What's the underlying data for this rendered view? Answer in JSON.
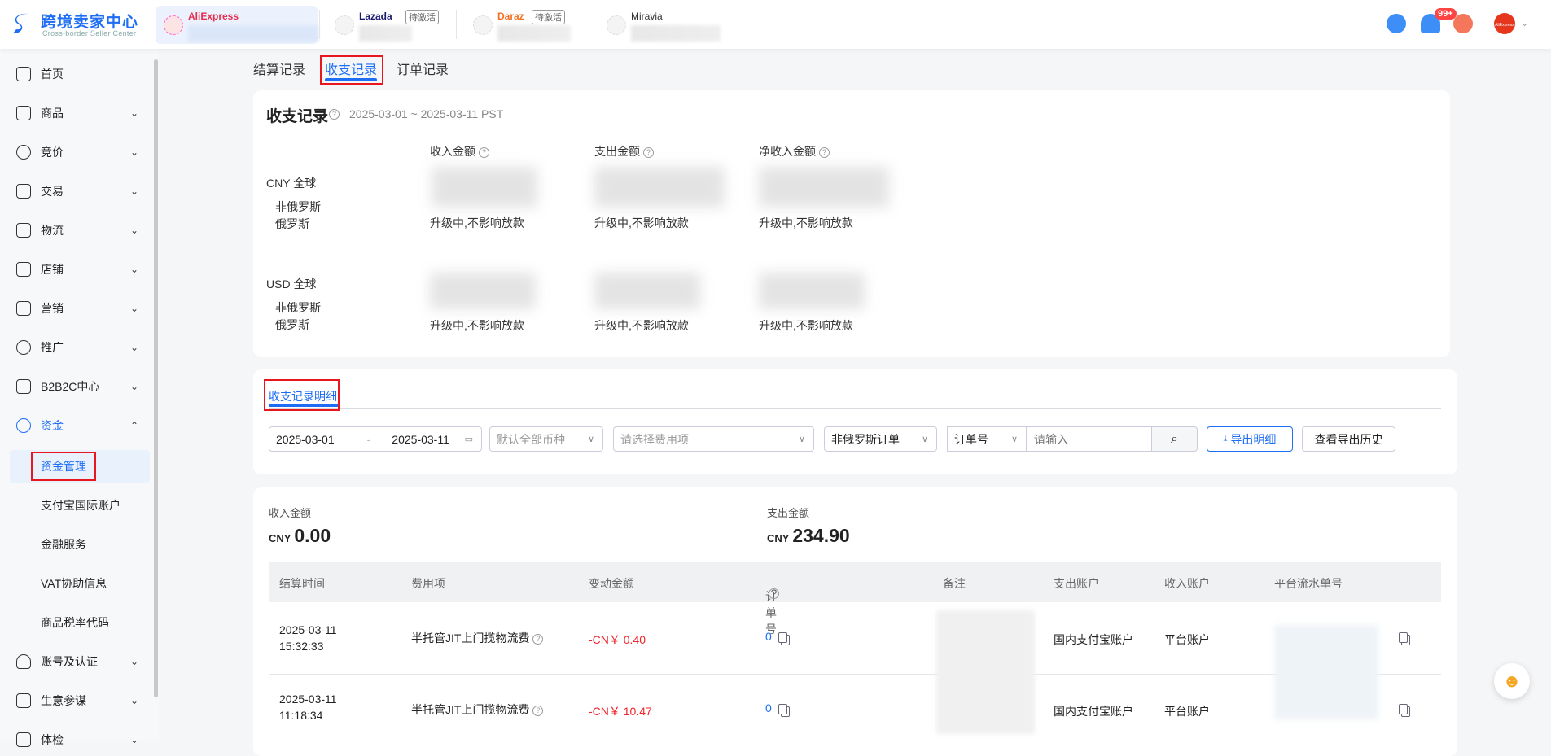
{
  "header": {
    "logo_title": "跨境卖家中心",
    "logo_subtitle": "Cross-border Seller Center",
    "shops": [
      {
        "name": "AliExpress",
        "badge": ""
      },
      {
        "name": "Lazada",
        "badge": "待激活"
      },
      {
        "name": "Daraz",
        "badge": "待激活"
      },
      {
        "name": "Miravia",
        "badge": ""
      }
    ],
    "notification_count": "99+",
    "avatar_text": "AliExpress"
  },
  "sidebar": {
    "items": [
      {
        "label": "首页"
      },
      {
        "label": "商品"
      },
      {
        "label": "竞价"
      },
      {
        "label": "交易"
      },
      {
        "label": "物流"
      },
      {
        "label": "店铺"
      },
      {
        "label": "营销"
      },
      {
        "label": "推广"
      },
      {
        "label": "B2B2C中心"
      },
      {
        "label": "资金"
      },
      {
        "label": "账号及认证"
      },
      {
        "label": "生意参谋"
      },
      {
        "label": "体检"
      }
    ],
    "sub_items": [
      {
        "label": "资金管理"
      },
      {
        "label": "支付宝国际账户"
      },
      {
        "label": "金融服务"
      },
      {
        "label": "VAT协助信息"
      },
      {
        "label": "商品税率代码"
      }
    ]
  },
  "tabs": [
    {
      "label": "结算记录"
    },
    {
      "label": "收支记录"
    },
    {
      "label": "订单记录"
    }
  ],
  "summary": {
    "title": "收支记录",
    "date_range": "2025-03-01 ~ 2025-03-11 PST",
    "columns": [
      "收入金额",
      "支出金额",
      "净收入金额"
    ],
    "groups": [
      {
        "label": "CNY 全球",
        "sub": [
          "非俄罗斯",
          "俄罗斯"
        ]
      },
      {
        "label": "USD 全球",
        "sub": [
          "非俄罗斯",
          "俄罗斯"
        ]
      }
    ],
    "upgrading_text": "升级中,不影响放款"
  },
  "detail": {
    "tab": "收支记录明细",
    "date_start": "2025-03-01",
    "date_end": "2025-03-11",
    "currency_placeholder": "默认全部币种",
    "fee_placeholder": "请选择费用项",
    "region": "非俄罗斯订单",
    "search_type": "订单号",
    "search_placeholder": "请输入",
    "export": "导出明细",
    "history": "查看导出历史"
  },
  "totals": {
    "income_label": "收入金额",
    "income_currency": "CNY",
    "income_value": "0.00",
    "expense_label": "支出金额",
    "expense_currency": "CNY",
    "expense_value": "234.90"
  },
  "table": {
    "headers": [
      "结算时间",
      "费用项",
      "变动金额",
      "订单号",
      "备注",
      "支出账户",
      "收入账户",
      "平台流水单号"
    ],
    "rows": [
      {
        "date": "2025-03-11",
        "time": "15:32:33",
        "fee": "半托管JIT上门揽物流费",
        "amount": "-CN￥ 0.40",
        "order": "0",
        "out": "国内支付宝账户",
        "in": "平台账户"
      },
      {
        "date": "2025-03-11",
        "time": "11:18:34",
        "fee": "半托管JIT上门揽物流费",
        "amount": "-CN￥ 10.47",
        "order": "0",
        "out": "国内支付宝账户",
        "in": "平台账户"
      }
    ]
  }
}
